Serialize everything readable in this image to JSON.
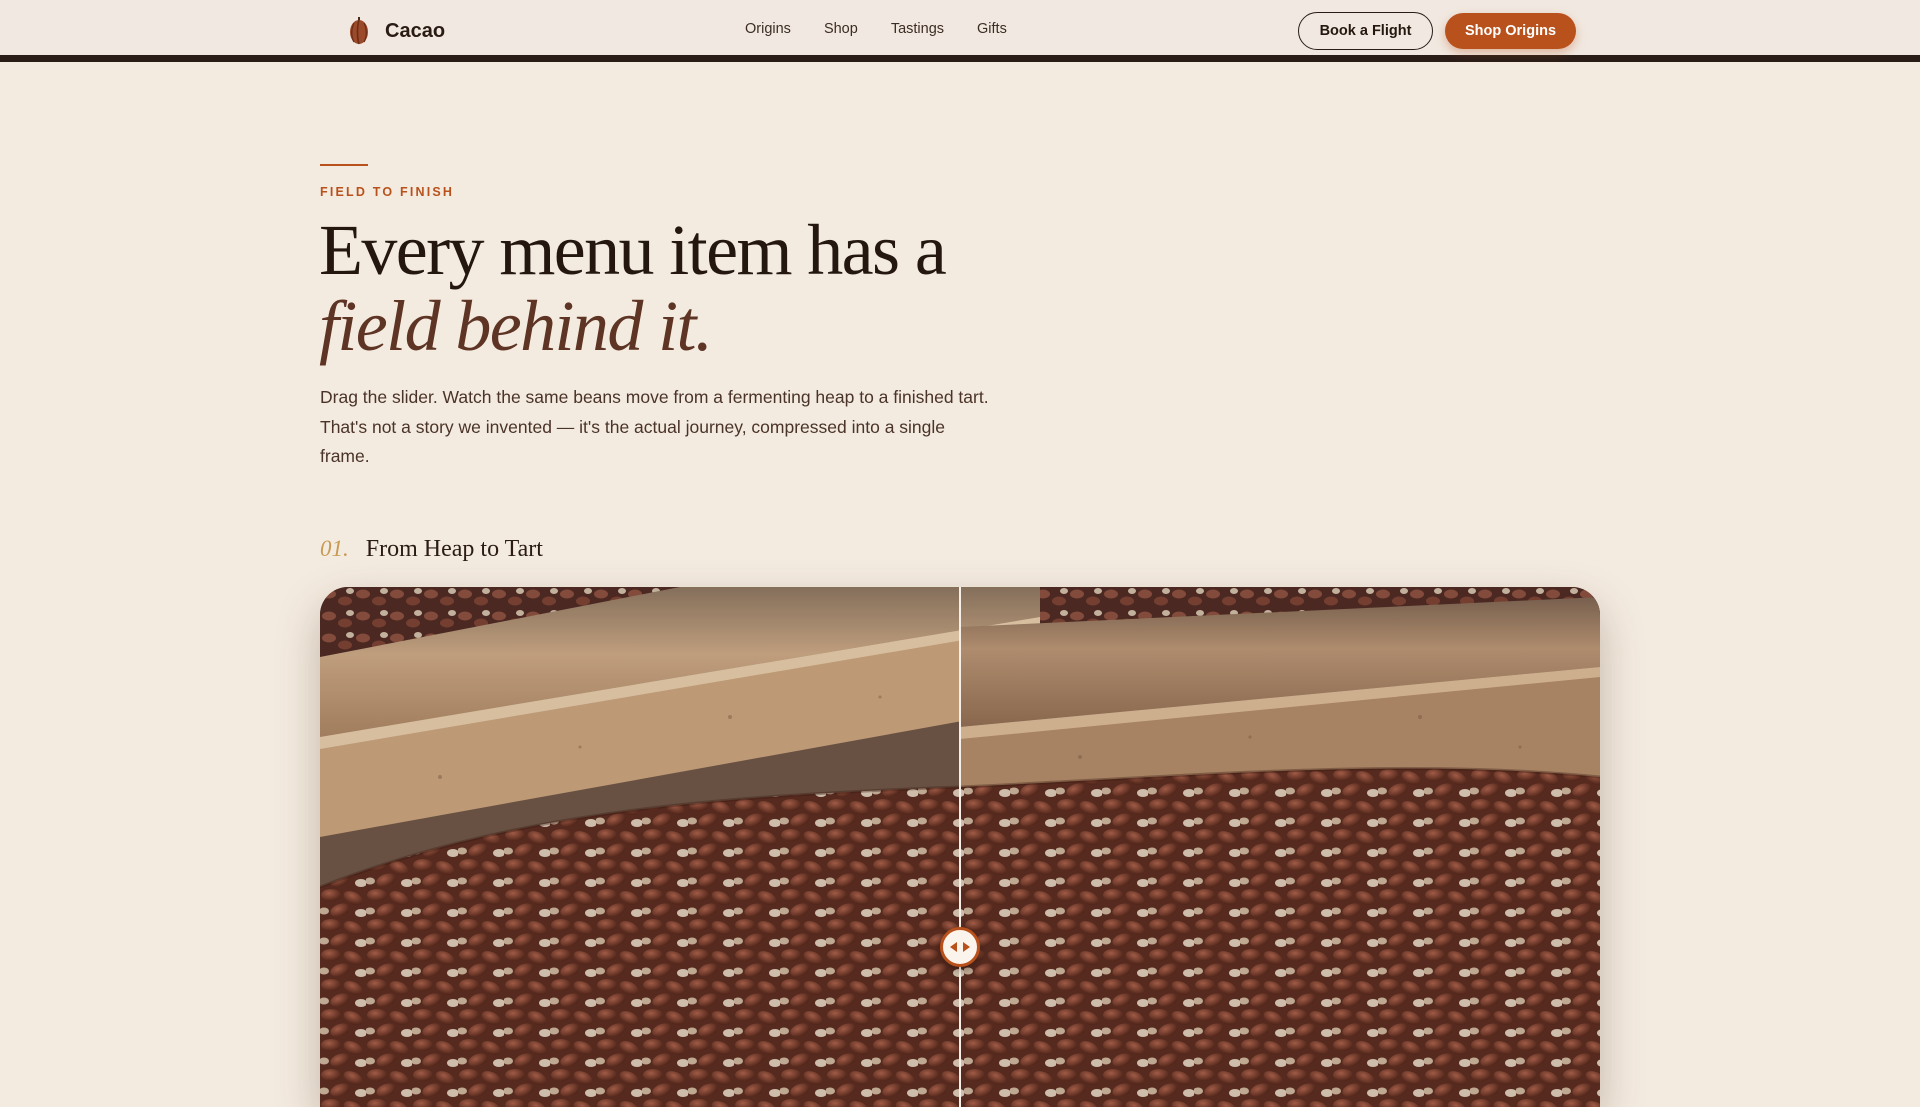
{
  "brand": {
    "name": "Cacao",
    "logo_icon": "cacao-pod-icon"
  },
  "nav": {
    "items": [
      "Origins",
      "Shop",
      "Tastings",
      "Gifts"
    ]
  },
  "actions": {
    "book_label": "Book a Flight",
    "shop_label": "Shop Origins"
  },
  "hero": {
    "eyebrow": "FIELD TO FINISH",
    "headline_line1": "Every menu item has a",
    "headline_line2": "field behind it.",
    "lede": "Drag the slider. Watch the same beans move from a fermenting heap to a finished tart. That's not a story we invented — it's the actual journey, compressed into a single frame."
  },
  "section": {
    "number": "01.",
    "title": "From Heap to Tart"
  },
  "compare_slider": {
    "position_percent": 50,
    "handle_icon": "left-right-arrows-icon"
  },
  "colors": {
    "accent": "#b9511c",
    "ink": "#24170f",
    "background": "#f4ebe0",
    "gold": "#c99a52"
  }
}
